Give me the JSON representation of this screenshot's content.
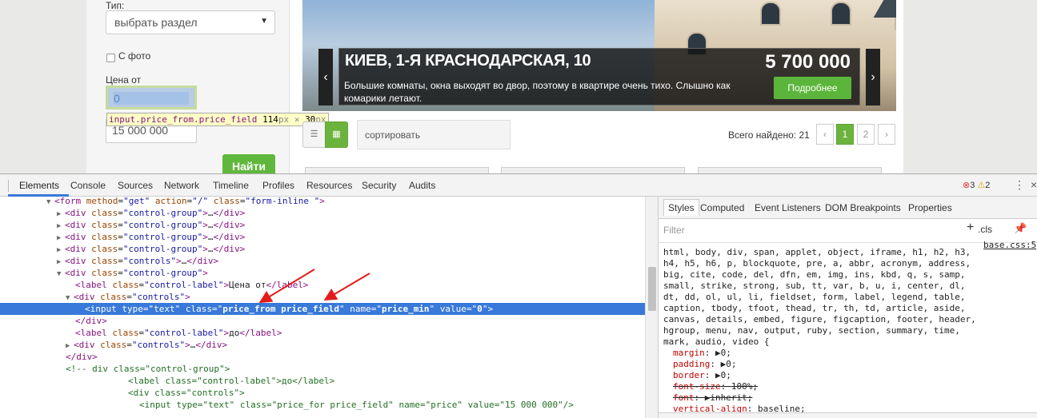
{
  "site": {
    "type_label": "Тип:",
    "section_select": "выбрать раздел",
    "photo_label": "С фото",
    "price_from_label": "Цена от",
    "price_from_value": "0",
    "price_to_value": "15 000 000",
    "find_button": "Найти",
    "tooltip": {
      "name": "input.price_from.price_field",
      "size_w": "114",
      "size_h": "30",
      "unit": "px",
      "times": "×"
    },
    "hero": {
      "title": "КИЕВ, 1-Я КРАСНОДАРСКАЯ, 10",
      "price": "5 700 000",
      "description": "Большие комнаты, окна выходят во двор, поэтому в квартире очень тихо. Слышно как комарики летают.",
      "more_button": "Подробнее"
    },
    "sort_placeholder": "сортировать",
    "total_found": "Всего найдено: 21",
    "pagination": [
      "‹",
      "1",
      "2",
      "›"
    ]
  },
  "devtools": {
    "tabs": [
      "Elements",
      "Console",
      "Sources",
      "Network",
      "Timeline",
      "Profiles",
      "Resources",
      "Security",
      "Audits"
    ],
    "errors": "3",
    "warnings": "2",
    "styles_tabs": [
      "Styles",
      "Computed",
      "Event Listeners",
      "DOM Breakpoints",
      "Properties"
    ],
    "filter_placeholder": "Filter",
    "cls_label": ".cls",
    "plus_icon": "+",
    "source_link": "base.css:5",
    "selector": "html, body, div, span, applet, object, iframe, h1, h2, h3, h4, h5, h6, p, blockquote, pre, a, abbr, acronym, address, big, cite, code, del, dfn, em, img, ins, kbd, q, s, samp, small, strike, strong, sub, tt, var, b, u, i, center, dl, dt, dd, ol, ul, li, fieldset, form, label, legend, table, caption, tbody, tfoot, thead, tr, th, td, article, aside, canvas, details, embed, figure, figcaption, footer, header, hgroup, menu, nav, output, ruby, section, summary, time, mark, audio, video {",
    "props": [
      {
        "name": "margin",
        "value": "▶0;",
        "struck": false
      },
      {
        "name": "padding",
        "value": "▶0;",
        "struck": false
      },
      {
        "name": "border",
        "value": "▶0;",
        "struck": false
      },
      {
        "name": "font-size",
        "value": "100%;",
        "struck": true
      },
      {
        "name": "font",
        "value": "▶inherit;",
        "struck": true
      },
      {
        "name": "vertical-align",
        "value": "baseline;",
        "struck": false
      }
    ],
    "close_brace": "}"
  },
  "colors": {
    "accent_green": "#6cb33e",
    "selection_blue": "#3879d9",
    "arrow_red": "#e31b1b"
  }
}
